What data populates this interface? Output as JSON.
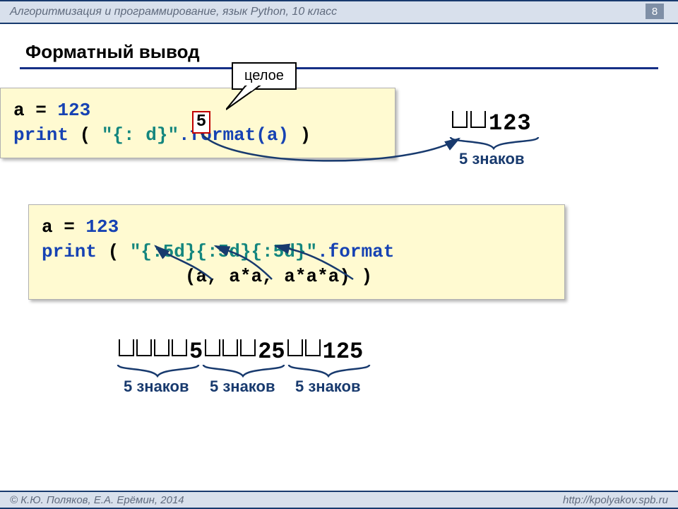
{
  "header": {
    "subject": "Алгоритмизация и программирование, язык Python, 10 класс",
    "page": "8"
  },
  "title": "Форматный вывод",
  "callout": "целое",
  "box_digit": "5",
  "code1": {
    "l1a": "a = ",
    "l1b": "123",
    "l2a": "print",
    "l2b": " ( ",
    "l2c": "\"{: d}\"",
    "l2d": ".format(a)",
    "l2e": " )"
  },
  "output1": {
    "text": "123",
    "brace": "5 знаков"
  },
  "code2": {
    "l1a": "a = ",
    "l1b": "123",
    "l2a": "print",
    "l2b": " ( ",
    "l2c": "\"{:5d}{:5d}{:5d}\"",
    "l2d": ".format",
    "l3": "             (a, a*a, a*a*a) )"
  },
  "output2": {
    "v1": "5",
    "v2": "25",
    "v3": "125"
  },
  "braces": {
    "b1": "5 знаков",
    "b2": "5 знаков",
    "b3": "5 знаков"
  },
  "footer": {
    "left": "© К.Ю. Поляков, Е.А. Ерёмин, 2014",
    "right": "http://kpolyakov.spb.ru"
  }
}
